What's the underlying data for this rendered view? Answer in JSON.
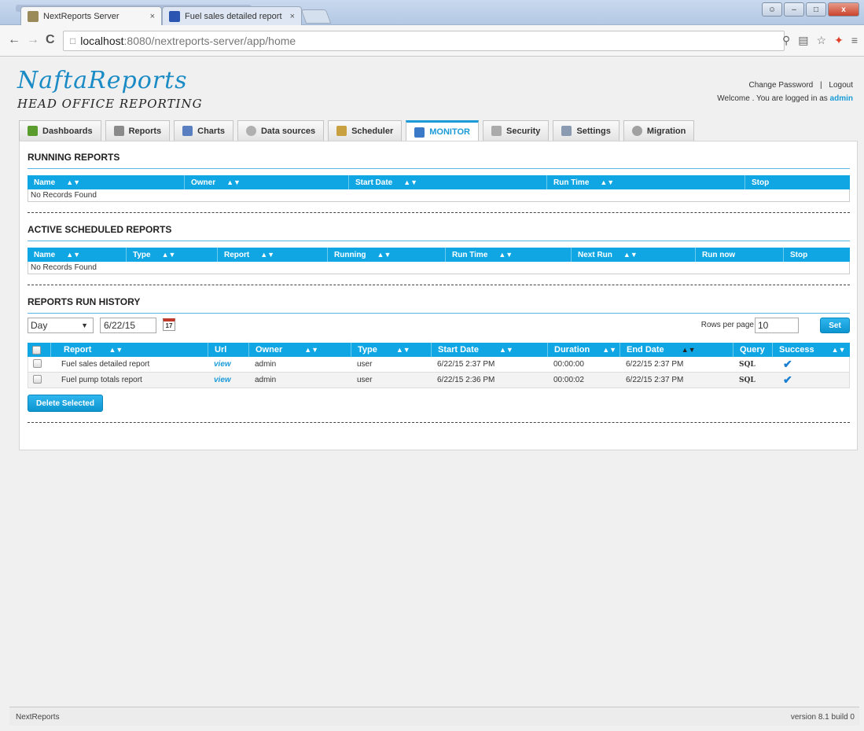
{
  "browser": {
    "tabs": [
      {
        "title": "NextReports Server",
        "close": "×"
      },
      {
        "title": "Fuel sales detailed report",
        "close": "×"
      }
    ],
    "url_host": "localhost",
    "url_path": ":8080/nextreports-server/app/home",
    "window_controls": {
      "minimize": "–",
      "maximize": "□",
      "close": "x"
    }
  },
  "header": {
    "logo_title": "NaftaReports",
    "logo_subtitle": "HEAD OFFICE REPORTING",
    "change_password": "Change Password",
    "separator": "|",
    "logout": "Logout",
    "welcome": "Welcome . You are logged in as",
    "user": "admin"
  },
  "tabs": [
    {
      "label": "Dashboards",
      "icon": "dashboard-icon",
      "color": "#5a9c2e"
    },
    {
      "label": "Reports",
      "icon": "report-icon",
      "color": "#8a8a8a"
    },
    {
      "label": "Charts",
      "icon": "chart-icon",
      "color": "#5a7fc0"
    },
    {
      "label": "Data sources",
      "icon": "datasource-icon",
      "color": "#b0b0b0"
    },
    {
      "label": "Scheduler",
      "icon": "hourglass-icon",
      "color": "#c8a040"
    },
    {
      "label": "MONITOR",
      "icon": "monitor-icon",
      "color": "#3a78c8",
      "active": true
    },
    {
      "label": "Security",
      "icon": "security-icon",
      "color": "#aaaaaa"
    },
    {
      "label": "Settings",
      "icon": "wrench-icon",
      "color": "#8a9ab0"
    },
    {
      "label": "Migration",
      "icon": "migration-icon",
      "color": "#a0a0a0"
    }
  ],
  "running_reports": {
    "title": "RUNNING REPORTS",
    "columns": [
      "Name",
      "Owner",
      "Start Date",
      "Run Time",
      "Stop"
    ],
    "empty": "No Records Found"
  },
  "scheduled_reports": {
    "title": "ACTIVE SCHEDULED REPORTS",
    "columns": [
      "Name",
      "Type",
      "Report",
      "Running",
      "Run Time",
      "Next Run",
      "Run now",
      "Stop"
    ],
    "empty": "No Records Found"
  },
  "history": {
    "title": "REPORTS RUN HISTORY",
    "period": "Day",
    "date": "6/22/15",
    "calendar_day": "17",
    "rows_per_page_label": "Rows per page",
    "rows_per_page": "10",
    "set_label": "Set",
    "columns": [
      "Report",
      "Url",
      "Owner",
      "Type",
      "Start Date",
      "Duration",
      "End Date",
      "Query",
      "Success"
    ],
    "rows": [
      {
        "report": "Fuel sales detailed report",
        "url": "view",
        "owner": "admin",
        "type": "user",
        "start": "6/22/15 2:37 PM",
        "duration": "00:00:00",
        "end": "6/22/15 2:37 PM",
        "query": "SQL",
        "success": "✔"
      },
      {
        "report": "Fuel pump totals report",
        "url": "view",
        "owner": "admin",
        "type": "user",
        "start": "6/22/15 2:36 PM",
        "duration": "00:00:02",
        "end": "6/22/15 2:37 PM",
        "query": "SQL",
        "success": "✔"
      }
    ],
    "delete_label": "Delete Selected"
  },
  "footer": {
    "left": "NextReports",
    "right": "version 8.1 build 0"
  }
}
